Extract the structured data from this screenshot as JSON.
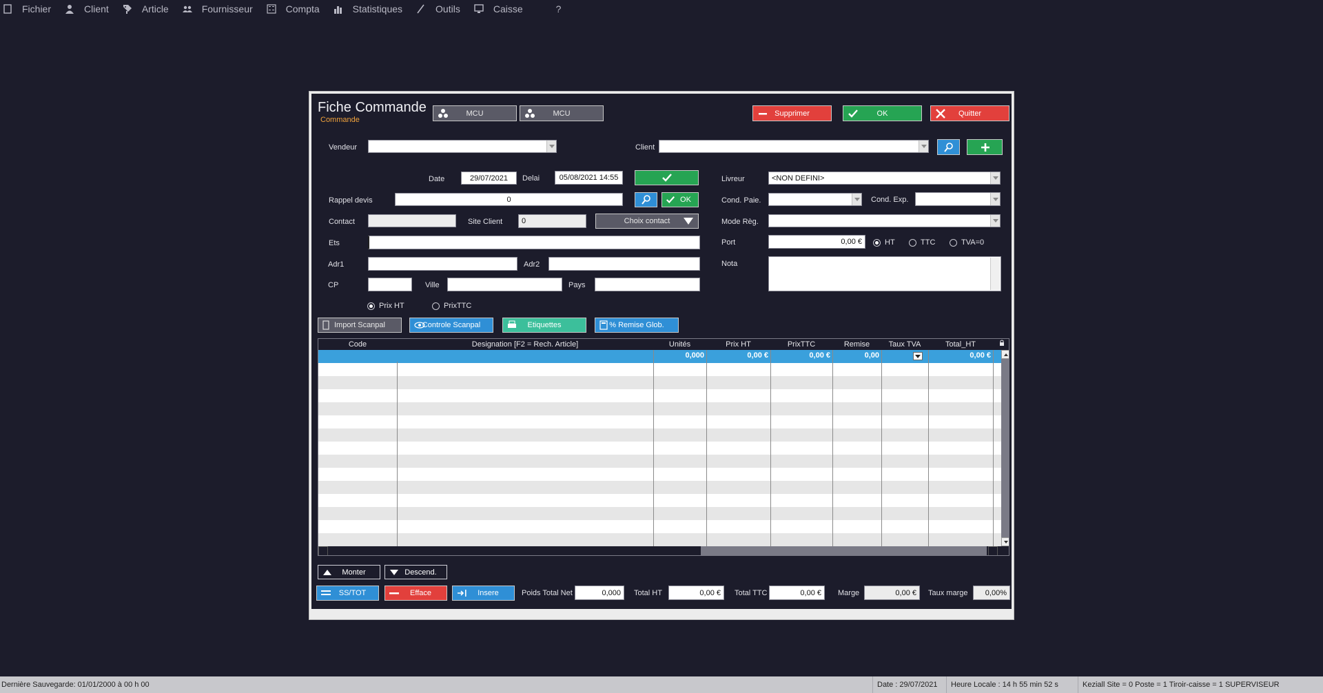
{
  "menu": [
    {
      "label": "Fichier",
      "icon": "file-icon"
    },
    {
      "label": "Client",
      "icon": "person-icon"
    },
    {
      "label": "Article",
      "icon": "tag-icon"
    },
    {
      "label": "Fournisseur",
      "icon": "people-icon"
    },
    {
      "label": "Compta",
      "icon": "calculator-icon"
    },
    {
      "label": "Statistiques",
      "icon": "chart-icon"
    },
    {
      "label": "Outils",
      "icon": "wand-icon"
    },
    {
      "label": "Caisse",
      "icon": "monitor-icon"
    },
    {
      "label": "?",
      "icon": ""
    }
  ],
  "header": {
    "title": "Fiche Commande",
    "subtitle": "Commande",
    "mcu1": "MCU",
    "mcu2": "MCU",
    "supprimer": "Supprimer",
    "ok": "OK",
    "quitter": "Quitter"
  },
  "form": {
    "vendeur_label": "Vendeur",
    "vendeur_value": "",
    "client_label": "Client",
    "client_value": "",
    "date_label": "Date",
    "date_value": "29/07/2021",
    "delai_label": "Delai",
    "delai_value": "05/08/2021 14:55",
    "livreur_label": "Livreur",
    "livreur_value": "<NON DEFINI>",
    "rappel_label": "Rappel devis",
    "rappel_value": "0",
    "rappel_ok": "OK",
    "cond_paie_label": "Cond. Paie.",
    "cond_exp_label": "Cond. Exp.",
    "contact_label": "Contact",
    "site_client_label": "Site Client",
    "site_client_value": "0",
    "choix_contact": "Choix contact",
    "mode_reg_label": "Mode Règ.",
    "ets_label": "Ets",
    "port_label": "Port",
    "port_value": "0,00 €",
    "ht_label": "HT",
    "ttc_label": "TTC",
    "tva0_label": "TVA=0",
    "adr1_label": "Adr1",
    "adr2_label": "Adr2",
    "nota_label": "Nota",
    "cp_label": "CP",
    "ville_label": "Ville",
    "pays_label": "Pays",
    "prix_ht_label": "Prix HT",
    "prix_ttc_label": "PrixTTC"
  },
  "tools": {
    "import": "Import Scanpal",
    "controle": "Controle Scanpal",
    "etiquettes": "Etiquettes",
    "remise": "% Remise Glob."
  },
  "grid": {
    "columns": [
      "Code",
      "Designation [F2 = Rech. Article]",
      "Unités",
      "Prix HT",
      "PrixTTC",
      "Remise",
      "Taux TVA",
      "Total_HT"
    ],
    "first_row": {
      "code": "",
      "designation": "",
      "unites": "0,000",
      "prix_ht": "0,00 €",
      "prix_ttc": "0,00 €",
      "remise": "0,00",
      "taux_tva": "",
      "total_ht": "0,00 €"
    }
  },
  "footer": {
    "monter": "Monter",
    "descend": "Descend.",
    "sstot": "SS/TOT",
    "efface": "Efface",
    "insere": "Insere",
    "poids_label": "Poids Total Net",
    "poids_value": "0,000",
    "total_ht_label": "Total HT",
    "total_ht_value": "0,00 €",
    "total_ttc_label": "Total TTC",
    "total_ttc_value": "0,00 €",
    "marge_label": "Marge",
    "marge_value": "0,00 €",
    "taux_marge_label": "Taux marge",
    "taux_marge_value": "0,00%"
  },
  "status": {
    "last_save": "Dernière Sauvegarde: 01/01/2000 à 00 h 00",
    "date": "Date : 29/07/2021",
    "heure": "Heure Locale : 14 h 55 min 52 s",
    "info": "Keziall  Site = 0  Poste = 1  Tiroir-caisse = 1 SUPERVISEUR"
  }
}
